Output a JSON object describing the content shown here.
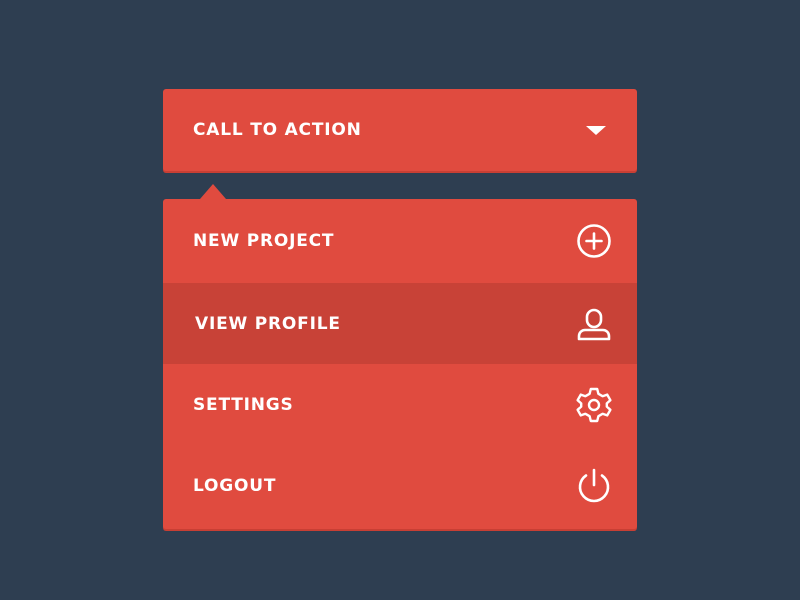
{
  "colors": {
    "background": "#2e3e51",
    "accent": "#e04b3f",
    "accent_active": "#c84237",
    "text": "#ffffff"
  },
  "cta": {
    "label": "CALL TO ACTION",
    "icon": "caret-down-icon"
  },
  "menu": {
    "items": [
      {
        "label": "NEW PROJECT",
        "icon": "plus-circle-icon",
        "active": false
      },
      {
        "label": "VIEW PROFILE",
        "icon": "user-icon",
        "active": true
      },
      {
        "label": "SETTINGS",
        "icon": "gear-icon",
        "active": false
      },
      {
        "label": "LOGOUT",
        "icon": "power-icon",
        "active": false
      }
    ]
  }
}
